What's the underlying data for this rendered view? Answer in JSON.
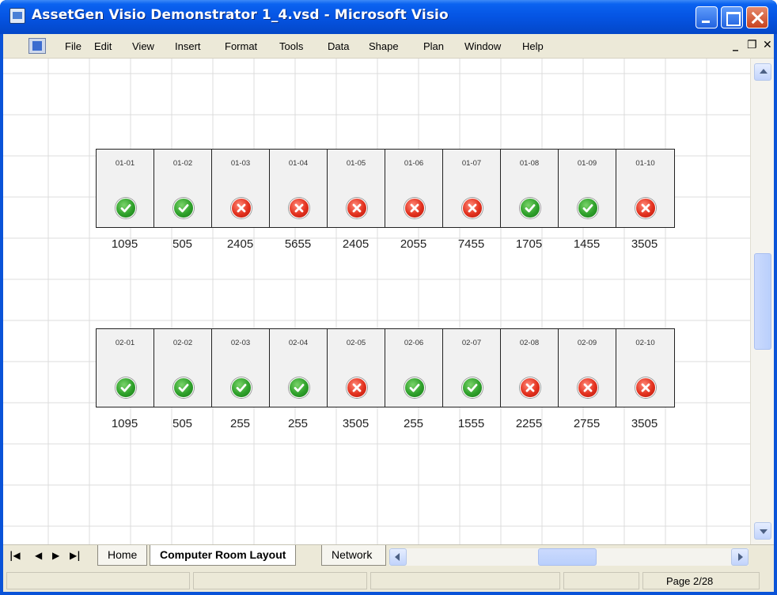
{
  "window": {
    "title": "AssetGen Visio Demonstrator 1_4.vsd - Microsoft Visio"
  },
  "menu": {
    "items": [
      "File",
      "Edit",
      "View",
      "Insert",
      "Format",
      "Tools",
      "Data",
      "Shape",
      "Plan",
      "Window",
      "Help"
    ]
  },
  "rows": [
    {
      "racks": [
        {
          "label": "01-01",
          "status": "ok",
          "value": "1095"
        },
        {
          "label": "01-02",
          "status": "ok",
          "value": "505"
        },
        {
          "label": "01-03",
          "status": "error",
          "value": "2405"
        },
        {
          "label": "01-04",
          "status": "error",
          "value": "5655"
        },
        {
          "label": "01-05",
          "status": "error",
          "value": "2405"
        },
        {
          "label": "01-06",
          "status": "error",
          "value": "2055"
        },
        {
          "label": "01-07",
          "status": "error",
          "value": "7455"
        },
        {
          "label": "01-08",
          "status": "ok",
          "value": "1705"
        },
        {
          "label": "01-09",
          "status": "ok",
          "value": "1455"
        },
        {
          "label": "01-10",
          "status": "error",
          "value": "3505"
        }
      ]
    },
    {
      "racks": [
        {
          "label": "02-01",
          "status": "ok",
          "value": "1095"
        },
        {
          "label": "02-02",
          "status": "ok",
          "value": "505"
        },
        {
          "label": "02-03",
          "status": "ok",
          "value": "255"
        },
        {
          "label": "02-04",
          "status": "ok",
          "value": "255"
        },
        {
          "label": "02-05",
          "status": "error",
          "value": "3505"
        },
        {
          "label": "02-06",
          "status": "ok",
          "value": "255"
        },
        {
          "label": "02-07",
          "status": "ok",
          "value": "1555"
        },
        {
          "label": "02-08",
          "status": "error",
          "value": "2255"
        },
        {
          "label": "02-09",
          "status": "error",
          "value": "2755"
        },
        {
          "label": "02-10",
          "status": "error",
          "value": "3505"
        }
      ]
    }
  ],
  "tabs": [
    {
      "label": "Home",
      "active": false
    },
    {
      "label": "Computer Room Layout",
      "active": true
    },
    {
      "label": "Network",
      "active": false
    }
  ],
  "status": {
    "page": "Page 2/28"
  },
  "colors": {
    "ok": "#2ea02a",
    "error": "#e2301d",
    "title_bar": "#0554e3",
    "chrome": "#ece9d8"
  }
}
